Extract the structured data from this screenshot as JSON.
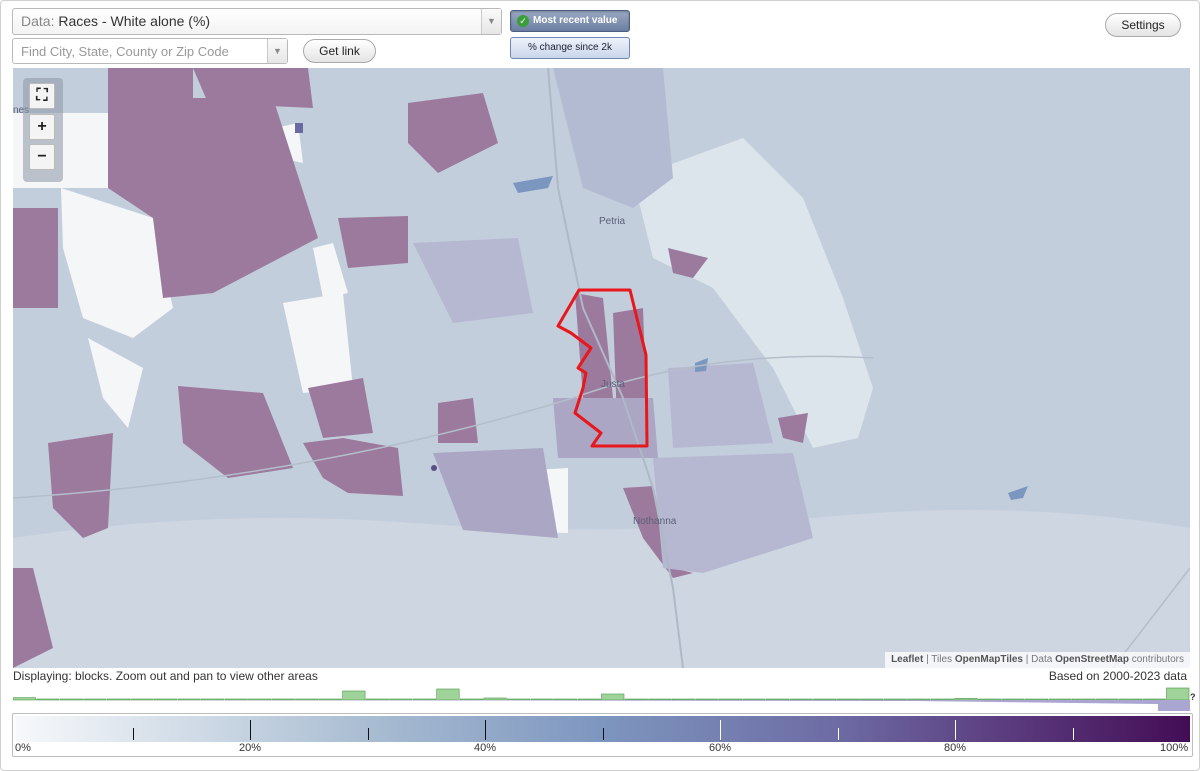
{
  "toolbar": {
    "data_prefix": "Data:",
    "data_value": "Races - White alone (%)",
    "search_placeholder": "Find City, State, County or Zip Code",
    "get_link_label": "Get link",
    "most_recent_label": "Most recent value",
    "change_label": "% change since 2k",
    "settings_label": "Settings"
  },
  "map": {
    "labels": [
      "Petria",
      "Justa",
      "Nothanna",
      "nes"
    ],
    "attribution": {
      "leaflet": "Leaflet",
      "tiles_prefix": "Tiles",
      "tiles": "OpenMapTiles",
      "data_prefix": "Data",
      "data": "OpenStreetMap",
      "contributors": "contributors"
    },
    "colors": {
      "base": "#c3cedc",
      "magenta": "#9c7a9e",
      "white_area": "#f2f4f7",
      "outline": "#e8171b"
    }
  },
  "status": {
    "displaying": "Displaying: blocks. Zoom out and pan to view other areas",
    "based_on": "Based on 2000-2023 data"
  },
  "histogram": {
    "unknown_label": "?",
    "bars": [
      0.12,
      0.02,
      0.02,
      0.02,
      0.02,
      0.02,
      0.02,
      0.02,
      0.02,
      0.02,
      0.02,
      0.02,
      0.02,
      0.02,
      0.45,
      0.02,
      0.02,
      0.02,
      0.55,
      0.02,
      0.1,
      0.02,
      0.02,
      0.02,
      0.02,
      0.3,
      0.02,
      0.02,
      0.02,
      0.02,
      0.02,
      0.02,
      0.02,
      0.02,
      0.02,
      0.02,
      0.02,
      0.02,
      0.02,
      0.02,
      0.08,
      0.02,
      0.02,
      0.02,
      0.02,
      0.02,
      0.02,
      0.02,
      0.02,
      0.6
    ]
  },
  "legend": {
    "min_label": "0%",
    "labels": [
      "0%",
      "20%",
      "40%",
      "60%",
      "80%",
      "100%"
    ]
  }
}
